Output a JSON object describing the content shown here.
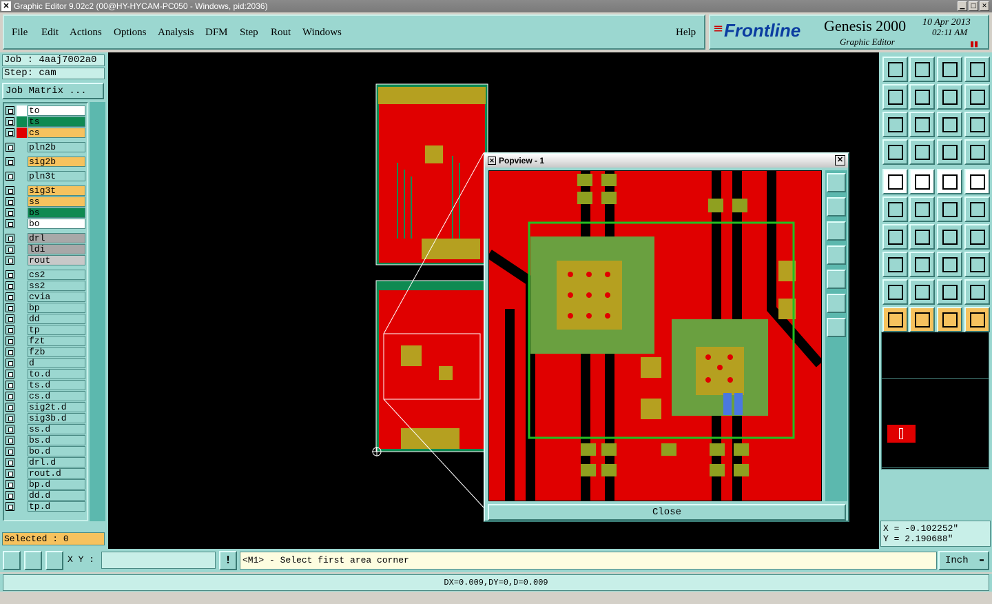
{
  "window": {
    "title": "Graphic Editor 9.02c2 (00@HY-HYCAM-PC050 - Windows, pid:2036)"
  },
  "menu": {
    "items": [
      "File",
      "Edit",
      "Actions",
      "Options",
      "Analysis",
      "DFM",
      "Step",
      "Rout",
      "Windows"
    ],
    "help": "Help"
  },
  "brand": {
    "logo": "Frontline",
    "product": "Genesis 2000",
    "subtitle": "Graphic Editor",
    "date": "10 Apr 2013",
    "time": "02:11 AM"
  },
  "job": {
    "job_label": "Job : 4aaj7002a0",
    "step_label": "Step: cam",
    "matrix_button": "Job Matrix ..."
  },
  "layers": [
    {
      "name": "to",
      "color": "#ffffff",
      "fill": "#ffffff"
    },
    {
      "name": "ts",
      "color": "#0f8a52",
      "fill": "#0f8a52"
    },
    {
      "name": "cs",
      "color": "#e00000",
      "fill": "#f6c25e"
    },
    {
      "name": "pln2b",
      "color": "#9bd7d0",
      "fill": "#9bd7d0"
    },
    {
      "name": "sig2b",
      "color": "#9bd7d0",
      "fill": "#f6c25e"
    },
    {
      "name": "pln3t",
      "color": "#9bd7d0",
      "fill": "#9bd7d0"
    },
    {
      "name": "sig3t",
      "color": "#9bd7d0",
      "fill": "#f6c25e"
    },
    {
      "name": "ss",
      "color": "#9bd7d0",
      "fill": "#f6c25e"
    },
    {
      "name": "bs",
      "color": "#9bd7d0",
      "fill": "#0f8a52"
    },
    {
      "name": "bo",
      "color": "#9bd7d0",
      "fill": "#ffffff"
    },
    {
      "name": "drl",
      "color": "#9bd7d0",
      "fill": "#a8a8a8"
    },
    {
      "name": "ldi",
      "color": "#9bd7d0",
      "fill": "#a8a8a8"
    },
    {
      "name": "rout",
      "color": "#9bd7d0",
      "fill": "#c8c8c8"
    },
    {
      "name": "cs2",
      "color": "#9bd7d0",
      "fill": "#9bd7d0"
    },
    {
      "name": "ss2",
      "color": "#9bd7d0",
      "fill": "#9bd7d0"
    },
    {
      "name": "cvia",
      "color": "#9bd7d0",
      "fill": "#9bd7d0"
    },
    {
      "name": "bp",
      "color": "#9bd7d0",
      "fill": "#9bd7d0"
    },
    {
      "name": "dd",
      "color": "#9bd7d0",
      "fill": "#9bd7d0"
    },
    {
      "name": "tp",
      "color": "#9bd7d0",
      "fill": "#9bd7d0"
    },
    {
      "name": "fzt",
      "color": "#9bd7d0",
      "fill": "#9bd7d0"
    },
    {
      "name": "fzb",
      "color": "#9bd7d0",
      "fill": "#9bd7d0"
    },
    {
      "name": "d",
      "color": "#9bd7d0",
      "fill": "#9bd7d0"
    },
    {
      "name": "to.d",
      "color": "#9bd7d0",
      "fill": "#9bd7d0"
    },
    {
      "name": "ts.d",
      "color": "#9bd7d0",
      "fill": "#9bd7d0"
    },
    {
      "name": "cs.d",
      "color": "#9bd7d0",
      "fill": "#9bd7d0"
    },
    {
      "name": "sig2t.d",
      "color": "#9bd7d0",
      "fill": "#9bd7d0"
    },
    {
      "name": "sig3b.d",
      "color": "#9bd7d0",
      "fill": "#9bd7d0"
    },
    {
      "name": "ss.d",
      "color": "#9bd7d0",
      "fill": "#9bd7d0"
    },
    {
      "name": "bs.d",
      "color": "#9bd7d0",
      "fill": "#9bd7d0"
    },
    {
      "name": "bo.d",
      "color": "#9bd7d0",
      "fill": "#9bd7d0"
    },
    {
      "name": "drl.d",
      "color": "#9bd7d0",
      "fill": "#9bd7d0"
    },
    {
      "name": "rout.d",
      "color": "#9bd7d0",
      "fill": "#9bd7d0"
    },
    {
      "name": "bp.d",
      "color": "#9bd7d0",
      "fill": "#9bd7d0"
    },
    {
      "name": "dd.d",
      "color": "#9bd7d0",
      "fill": "#9bd7d0"
    },
    {
      "name": "tp.d",
      "color": "#9bd7d0",
      "fill": "#9bd7d0"
    }
  ],
  "selected": "Selected : 0",
  "popup": {
    "title": "Popview - 1",
    "close": "Close"
  },
  "coords": {
    "x": "X = -0.102252\"",
    "y": "Y = 2.190688\""
  },
  "bottom": {
    "xy_label": "X Y :",
    "xy_value": "",
    "prompt": "<M1> - Select first area corner",
    "units": "Inch"
  },
  "status": "DX=0.009,DY=0,D=0.009"
}
